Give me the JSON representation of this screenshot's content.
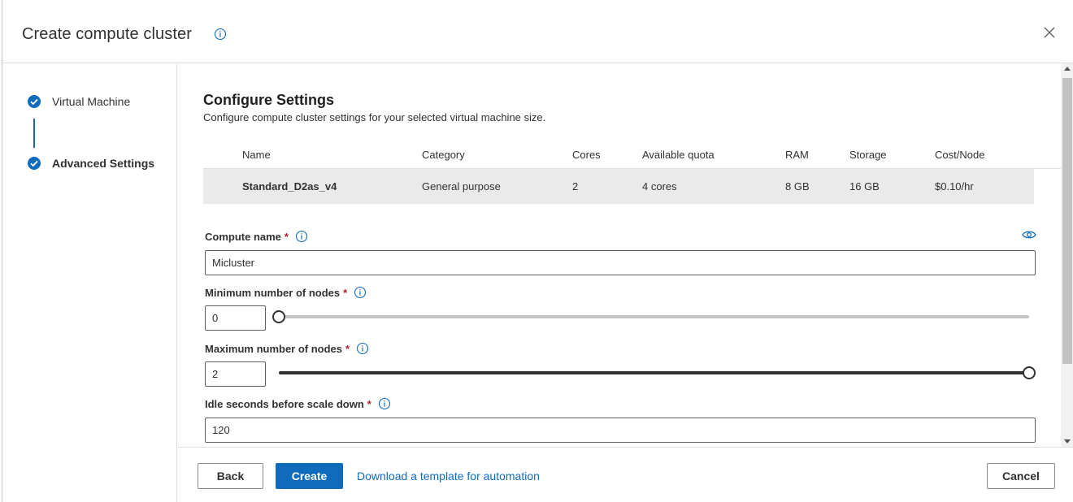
{
  "dialog": {
    "title": "Create compute cluster",
    "close_icon": "close-icon"
  },
  "steps": [
    {
      "label": "Virtual Machine",
      "status": "complete",
      "active": false
    },
    {
      "label": "Advanced Settings",
      "status": "complete",
      "active": true
    }
  ],
  "section": {
    "title": "Configure Settings",
    "subtitle": "Configure compute cluster settings for your selected virtual machine size."
  },
  "vm_table": {
    "columns": [
      "Name",
      "Category",
      "Cores",
      "Available quota",
      "RAM",
      "Storage",
      "Cost/Node"
    ],
    "row": [
      "Standard_D2as_v4",
      "General purpose",
      "2",
      "4 cores",
      "8 GB",
      "16 GB",
      "$0.10/hr"
    ]
  },
  "fields": {
    "compute_name": {
      "label": "Compute name",
      "required_mark": "*",
      "value": "Micluster"
    },
    "min_nodes": {
      "label": "Minimum number of nodes",
      "required_mark": "*",
      "value": "0",
      "slider_fraction": 0.0
    },
    "max_nodes": {
      "label": "Maximum number of nodes",
      "required_mark": "*",
      "value": "2",
      "slider_fraction": 1.0
    },
    "idle_seconds": {
      "label": "Idle seconds before scale down",
      "required_mark": "*",
      "value": "120"
    }
  },
  "footer": {
    "back_label": "Back",
    "create_label": "Create",
    "download_link": "Download a template for automation",
    "cancel_label": "Cancel"
  },
  "colors": {
    "accent": "#0f6cbd",
    "required": "#a4262c",
    "row_highlight": "#eaeaea"
  }
}
